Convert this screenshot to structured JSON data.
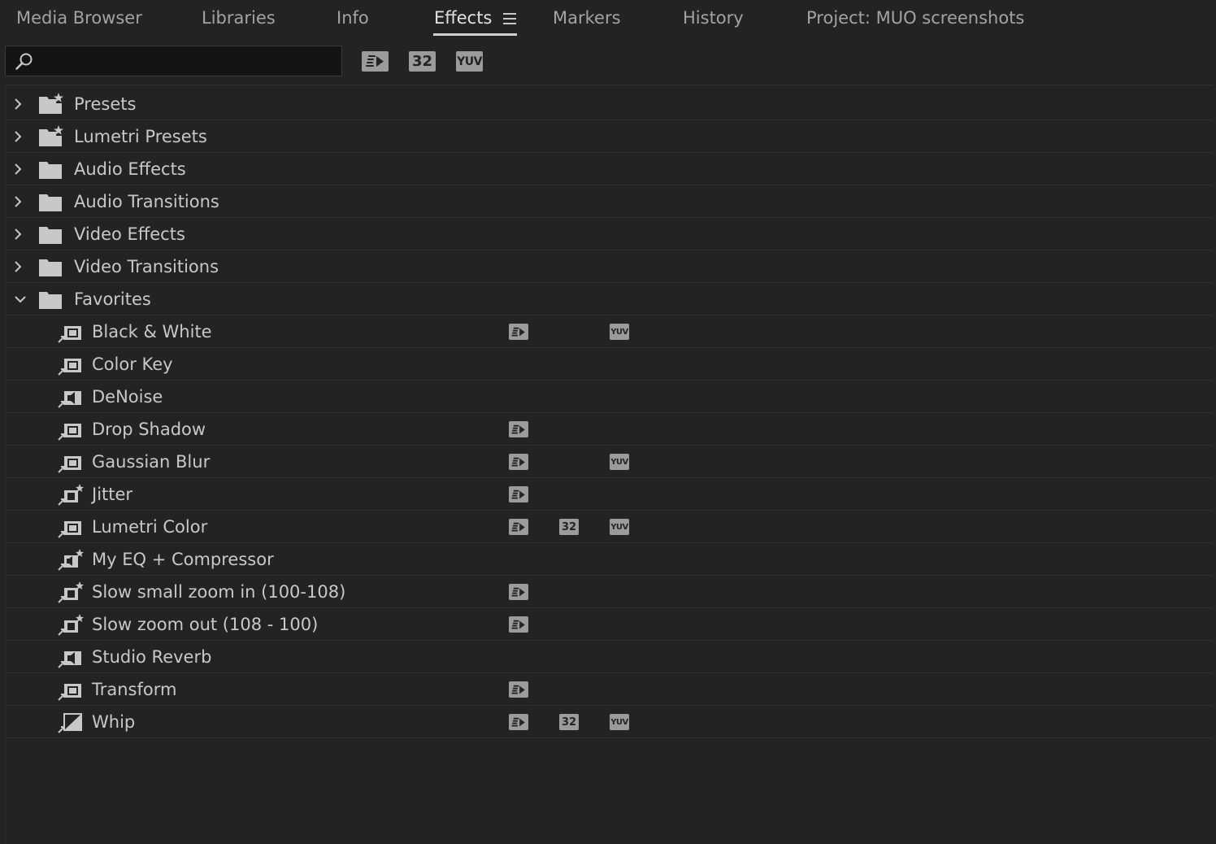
{
  "tabs": [
    {
      "label": "Media Browser",
      "active": false
    },
    {
      "label": "Libraries",
      "active": false
    },
    {
      "label": "Info",
      "active": false
    },
    {
      "label": "Effects",
      "active": true
    },
    {
      "label": "Markers",
      "active": false
    },
    {
      "label": "History",
      "active": false
    },
    {
      "label": "Project: MUO screenshots",
      "active": false
    }
  ],
  "search": {
    "value": "",
    "placeholder": ""
  },
  "filter_buttons": [
    {
      "icon": "accelerated-effects-icon",
      "label": ""
    },
    {
      "icon": "32-bit-icon",
      "label": "32"
    },
    {
      "icon": "yuv-icon",
      "label": "YUV"
    }
  ],
  "folders": [
    {
      "label": "Presets",
      "icon": "preset-folder-icon",
      "expanded": false
    },
    {
      "label": "Lumetri Presets",
      "icon": "preset-folder-icon",
      "expanded": false
    },
    {
      "label": "Audio Effects",
      "icon": "folder-icon",
      "expanded": false
    },
    {
      "label": "Audio Transitions",
      "icon": "folder-icon",
      "expanded": false
    },
    {
      "label": "Video Effects",
      "icon": "folder-icon",
      "expanded": false
    },
    {
      "label": "Video Transitions",
      "icon": "folder-icon",
      "expanded": false
    },
    {
      "label": "Favorites",
      "icon": "folder-icon",
      "expanded": true
    }
  ],
  "favorites": [
    {
      "label": "Black & White",
      "icon": "video-effect-icon",
      "accelerated": true,
      "bit32": false,
      "yuv": true
    },
    {
      "label": "Color Key",
      "icon": "video-effect-icon",
      "accelerated": false,
      "bit32": false,
      "yuv": false
    },
    {
      "label": "DeNoise",
      "icon": "audio-effect-icon",
      "accelerated": false,
      "bit32": false,
      "yuv": false
    },
    {
      "label": "Drop Shadow",
      "icon": "video-effect-icon",
      "accelerated": true,
      "bit32": false,
      "yuv": false
    },
    {
      "label": "Gaussian Blur",
      "icon": "video-effect-icon",
      "accelerated": true,
      "bit32": false,
      "yuv": true
    },
    {
      "label": "Jitter",
      "icon": "effect-preset-icon",
      "accelerated": true,
      "bit32": false,
      "yuv": false
    },
    {
      "label": "Lumetri Color",
      "icon": "video-effect-icon",
      "accelerated": true,
      "bit32": true,
      "yuv": true
    },
    {
      "label": "My EQ + Compressor",
      "icon": "audio-preset-icon",
      "accelerated": false,
      "bit32": false,
      "yuv": false
    },
    {
      "label": "Slow small zoom in (100-108)",
      "icon": "effect-preset-icon",
      "accelerated": true,
      "bit32": false,
      "yuv": false
    },
    {
      "label": "Slow zoom out (108 - 100)",
      "icon": "effect-preset-icon",
      "accelerated": true,
      "bit32": false,
      "yuv": false
    },
    {
      "label": "Studio Reverb",
      "icon": "audio-effect-icon",
      "accelerated": false,
      "bit32": false,
      "yuv": false
    },
    {
      "label": "Transform",
      "icon": "video-effect-icon",
      "accelerated": true,
      "bit32": false,
      "yuv": false
    },
    {
      "label": "Whip",
      "icon": "transition-icon",
      "accelerated": true,
      "bit32": true,
      "yuv": true
    }
  ],
  "colors": {
    "background": "#232323",
    "text": "#c8c8c8",
    "badge": "#9b9b9b",
    "divider": "#303030",
    "search_bg": "#141414"
  }
}
